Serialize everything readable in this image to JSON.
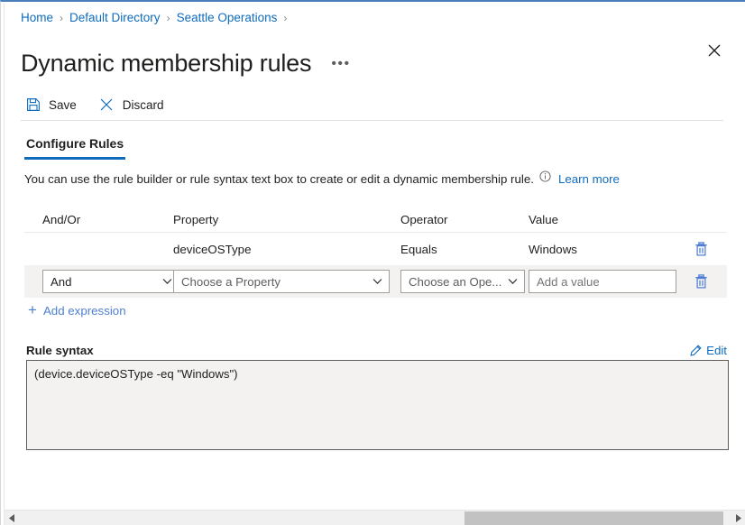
{
  "breadcrumb": {
    "items": [
      {
        "label": "Home"
      },
      {
        "label": "Default Directory"
      },
      {
        "label": "Seattle Operations"
      }
    ],
    "separator": "›"
  },
  "header": {
    "title": "Dynamic membership rules",
    "more_label": "•••",
    "close_icon": "close-icon"
  },
  "toolbar": {
    "save_label": "Save",
    "save_icon": "save-floppy-icon",
    "discard_label": "Discard",
    "discard_icon": "discard-x-icon"
  },
  "tabs": [
    {
      "label": "Configure Rules",
      "active": true
    }
  ],
  "description": {
    "text": "You can use the rule builder or rule syntax text box to create or edit a dynamic membership rule.",
    "info_icon": "info-circle-icon",
    "learn_more_label": "Learn more"
  },
  "rules_table": {
    "headers": {
      "andor": "And/Or",
      "property": "Property",
      "operator": "Operator",
      "value": "Value"
    },
    "existing_row": {
      "andor": "",
      "property": "deviceOSType",
      "operator": "Equals",
      "value": "Windows",
      "delete_icon": "trash-icon"
    },
    "editing_row": {
      "andor_value": "And",
      "property_placeholder": "Choose a Property",
      "operator_placeholder": "Choose an Ope...",
      "value_placeholder": "Add a value",
      "value_current": "",
      "delete_icon": "trash-icon",
      "chevron_icon": "chevron-down-icon"
    },
    "add_expression_label": "Add expression",
    "add_expression_icon": "plus-icon"
  },
  "rule_syntax": {
    "label": "Rule syntax",
    "edit_label": "Edit",
    "edit_icon": "pencil-icon",
    "content": "(device.deviceOSType -eq \"Windows\")"
  },
  "scrollbar": {
    "left_arrow_icon": "triangle-left-icon",
    "right_arrow_icon": "triangle-right-icon"
  },
  "colors": {
    "accent": "#0f6cbd",
    "link": "#4f7fd4",
    "top_border": "#4a7ebb",
    "row_highlight": "#f3f2f1",
    "syntax_bg": "#f3f2f1"
  }
}
